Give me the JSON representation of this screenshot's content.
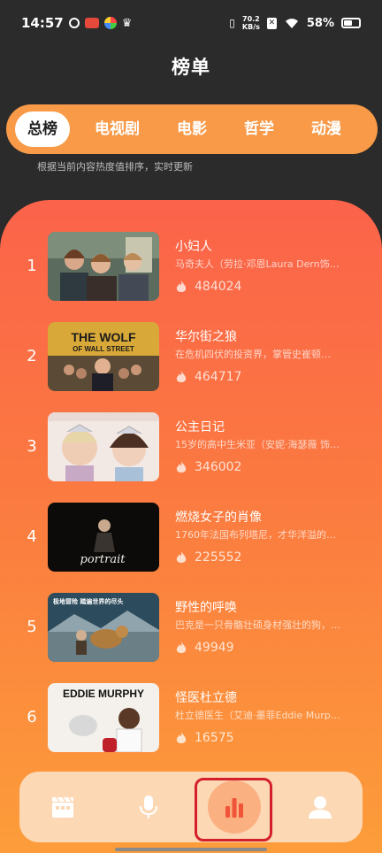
{
  "status_bar": {
    "time": "14:57",
    "net_speed_value": "70.2",
    "net_speed_unit": "KB/s",
    "battery": "58%"
  },
  "header": {
    "title": "榜单"
  },
  "tabs": [
    {
      "label": "总榜",
      "active": true
    },
    {
      "label": "电视剧",
      "active": false
    },
    {
      "label": "电影",
      "active": false
    },
    {
      "label": "哲学",
      "active": false
    },
    {
      "label": "动漫",
      "active": false
    }
  ],
  "subtitle": "根据当前内容热度值排序，实时更新",
  "rankings": [
    {
      "rank": "1",
      "title": "小妇人",
      "desc": "马奇夫人（劳拉·邓恩Laura Dern饰…",
      "heat": "484024",
      "poster_icon": "little-women-poster"
    },
    {
      "rank": "2",
      "title": "华尔街之狼",
      "desc": "在危机四伏的投资界，掌管史崔顿…",
      "heat": "464717",
      "poster_icon": "wolf-of-wall-street-poster",
      "poster_text_1": "THE WOLF",
      "poster_text_2": "OF WALL STREET"
    },
    {
      "rank": "3",
      "title": "公主日记",
      "desc": "15岁的高中生米亚（安妮·海瑟薇 饰…",
      "heat": "346002",
      "poster_icon": "princess-diaries-poster"
    },
    {
      "rank": "4",
      "title": "燃烧女子的肖像",
      "desc": "1760年法国布列塔尼，才华洋溢的…",
      "heat": "225552",
      "poster_icon": "portrait-lady-on-fire-poster",
      "poster_text_1": "portrait"
    },
    {
      "rank": "5",
      "title": "野性的呼唤",
      "desc": "巴克是一只骨骼壮硕身材强壮的狗，…",
      "heat": "49949",
      "poster_icon": "call-of-the-wild-poster",
      "poster_text_1": "极地冒险 踏遍世界的尽头"
    },
    {
      "rank": "6",
      "title": "怪医杜立德",
      "desc": "杜立德医生（艾迪·墨菲Eddie Murp…",
      "heat": "16575",
      "poster_icon": "dr-dolittle-poster",
      "poster_text_1": "EDDIE MURPHY"
    }
  ],
  "bottom_nav": [
    {
      "name": "nav-movies",
      "icon": "clapperboard-icon",
      "active": false
    },
    {
      "name": "nav-audio",
      "icon": "microphone-icon",
      "active": false
    },
    {
      "name": "nav-ranking",
      "icon": "bar-chart-icon",
      "active": true
    },
    {
      "name": "nav-profile",
      "icon": "person-icon",
      "active": false
    }
  ],
  "colors": {
    "background": "#2b2b2b",
    "tab_bar": "#f89a48",
    "panel_top": "#fb634a",
    "panel_bottom": "#fc9d3a",
    "nav_bg": "#fcd8b5",
    "nav_active": "#fbb081",
    "highlight": "#d4202a"
  }
}
